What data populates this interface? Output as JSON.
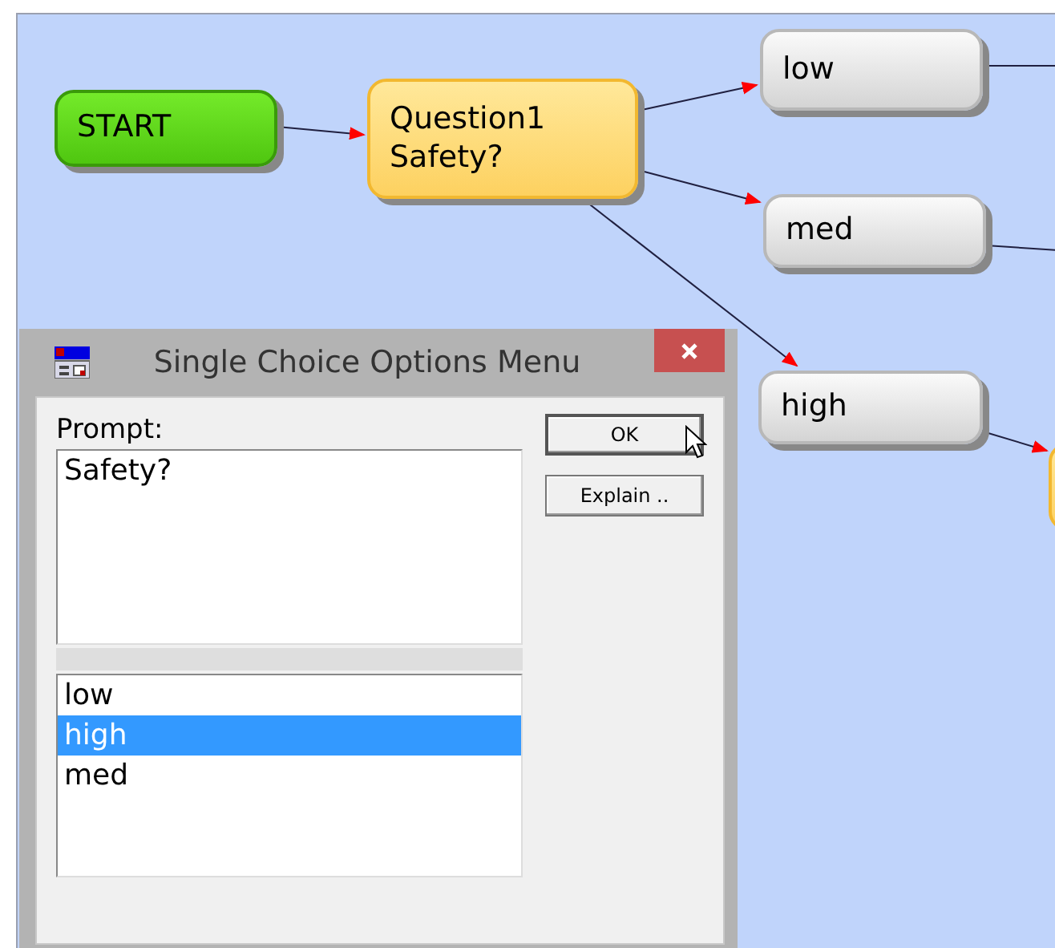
{
  "diagram": {
    "nodes": [
      {
        "kind": "start",
        "lines": [
          "START"
        ]
      },
      {
        "kind": "question",
        "lines": [
          "Question1",
          "Safety?"
        ]
      },
      {
        "kind": "answer",
        "lines": [
          "low"
        ]
      },
      {
        "kind": "answer",
        "lines": [
          "med"
        ]
      },
      {
        "kind": "answer",
        "lines": [
          "high"
        ]
      },
      {
        "kind": "question"
      }
    ]
  },
  "dialog": {
    "title": "Single Choice Options Menu",
    "prompt_label": "Prompt:",
    "prompt_value": "Safety?",
    "options": [
      {
        "label": "low",
        "selected": false
      },
      {
        "label": "high",
        "selected": true
      },
      {
        "label": "med",
        "selected": false
      }
    ],
    "buttons": [
      "OK",
      "Explain .."
    ]
  }
}
